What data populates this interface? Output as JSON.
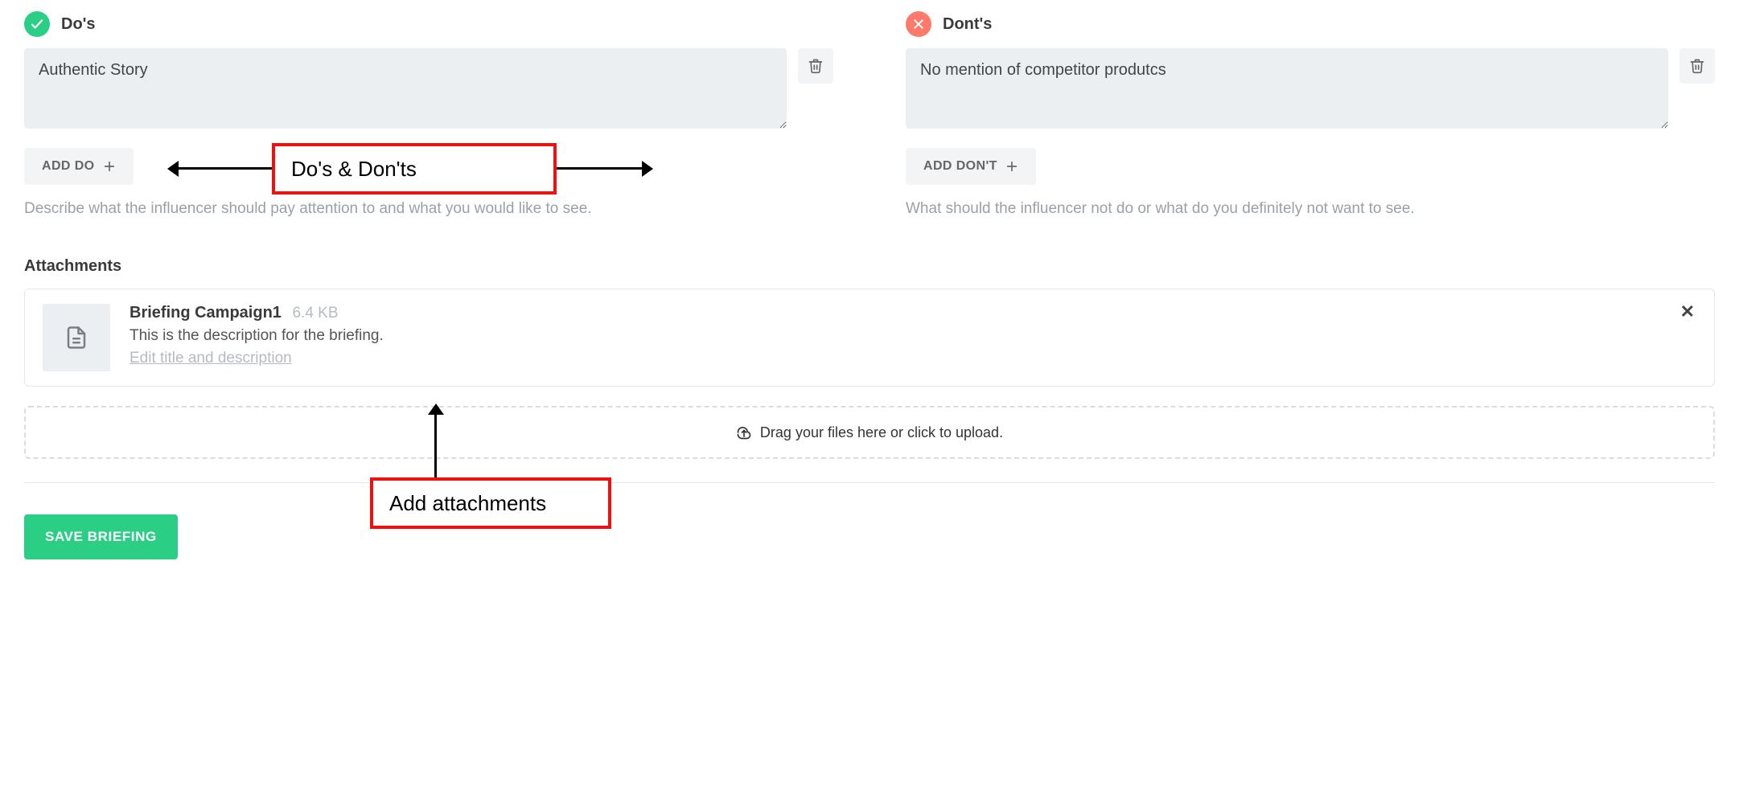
{
  "dos": {
    "title": "Do's",
    "items": [
      "Authentic Story"
    ],
    "add_label": "ADD DO",
    "help": "Describe what the influencer should pay attention to and what you would like to see."
  },
  "donts": {
    "title": "Dont's",
    "items": [
      "No mention of competitor produtcs"
    ],
    "add_label": "ADD DON'T",
    "help": "What should the influencer not do or what do you definitely not want to see."
  },
  "attachments": {
    "heading": "Attachments",
    "file": {
      "name": "Briefing Campaign1",
      "size": "6.4 KB",
      "description": "This is the description for the briefing.",
      "edit_label": "Edit title and description"
    },
    "dropzone_text": "Drag your files here or click to upload."
  },
  "save_label": "SAVE BRIEFING",
  "annotations": {
    "dos_donts": "Do's & Don'ts",
    "add_attachments": "Add attachments"
  }
}
